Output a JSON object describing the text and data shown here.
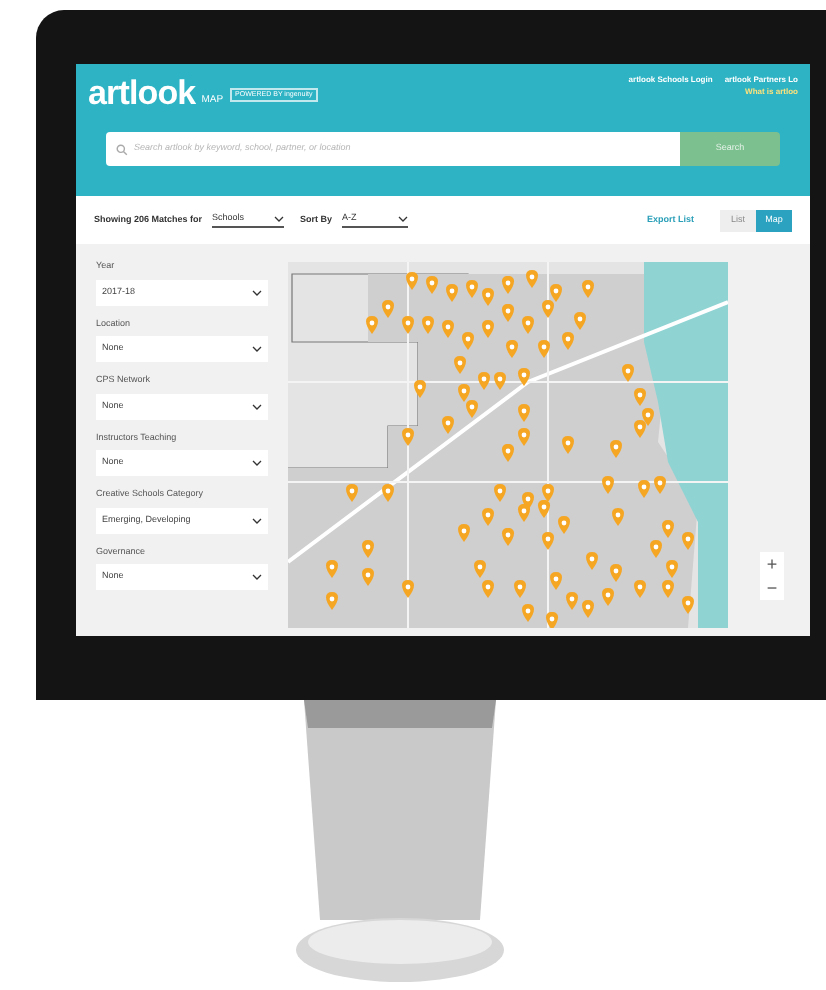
{
  "header": {
    "logo": "artlook",
    "logo_suffix": "MAP",
    "badge": "POWERED BY ingenuity",
    "links": [
      "artlook Schools Login",
      "artlook Partners Lo"
    ],
    "note": "What is artloo"
  },
  "search": {
    "placeholder": "Search artlook by keyword, school, partner, or location",
    "button": "Search"
  },
  "toolbar": {
    "matches": "Showing 206 Matches for",
    "type_value": "Schools",
    "sort_label": "Sort By",
    "sort_value": "A-Z",
    "export": "Export List",
    "views": [
      {
        "label": "List",
        "selected": false
      },
      {
        "label": "Map",
        "selected": true
      }
    ]
  },
  "filters": [
    {
      "label": "Year",
      "value": "2017-18"
    },
    {
      "label": "Location",
      "value": "None"
    },
    {
      "label": "CPS Network",
      "value": "None"
    },
    {
      "label": "Instructors Teaching",
      "value": "None"
    },
    {
      "label": "Creative Schools Category",
      "value": "Emerging, Developing"
    },
    {
      "label": "Governance",
      "value": "None"
    }
  ],
  "map": {
    "zoom_in": "+",
    "zoom_out": "−"
  }
}
